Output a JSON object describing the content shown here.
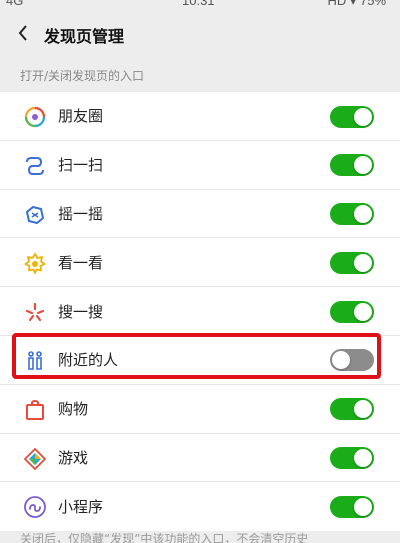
{
  "statusbar": {
    "left": "4G",
    "time": "10:31",
    "right": "HD ▾ 75%"
  },
  "header": {
    "title": "发现页管理"
  },
  "section_title": "打开/关闭发现页的入口",
  "items": [
    {
      "label": "朋友圈",
      "on": true
    },
    {
      "label": "扫一扫",
      "on": true
    },
    {
      "label": "摇一摇",
      "on": true
    },
    {
      "label": "看一看",
      "on": true
    },
    {
      "label": "搜一搜",
      "on": true
    },
    {
      "label": "附近的人",
      "on": false
    },
    {
      "label": "购物",
      "on": true
    },
    {
      "label": "游戏",
      "on": true
    },
    {
      "label": "小程序",
      "on": true
    }
  ],
  "footer_note": "关闭后，仅隐藏“发现”中该功能的入口，不会清空历史",
  "colors": {
    "switch_on": "#1aad19",
    "switch_off": "#8c8c8c",
    "highlight": "#e0101a"
  }
}
